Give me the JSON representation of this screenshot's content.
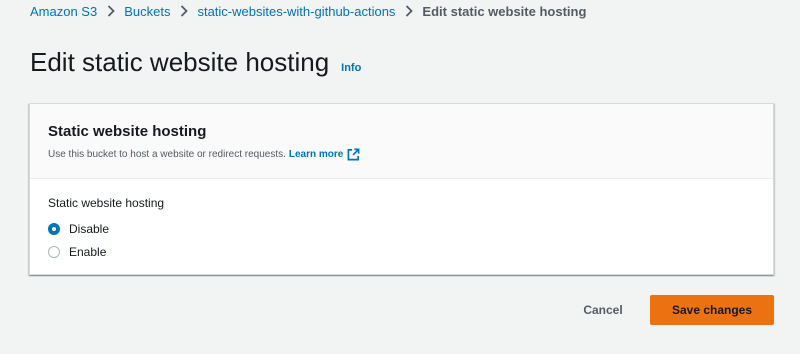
{
  "breadcrumb": {
    "items": [
      "Amazon S3",
      "Buckets",
      "static-websites-with-github-actions"
    ],
    "current": "Edit static website hosting"
  },
  "header": {
    "title": "Edit static website hosting",
    "info_label": "Info"
  },
  "section": {
    "heading": "Static website hosting",
    "description": "Use this bucket to host a website or redirect requests.",
    "learn_more": "Learn more",
    "field_label": "Static website hosting",
    "options": [
      {
        "label": "Disable",
        "selected": true
      },
      {
        "label": "Enable",
        "selected": false
      }
    ]
  },
  "actions": {
    "cancel_label": "Cancel",
    "save_label": "Save changes"
  },
  "colors": {
    "link": "#0073bb",
    "primary_button": "#ec7211",
    "background": "#f2f3f3"
  },
  "icons": {
    "separator": "chevron-right-icon",
    "external": "external-link-icon"
  }
}
